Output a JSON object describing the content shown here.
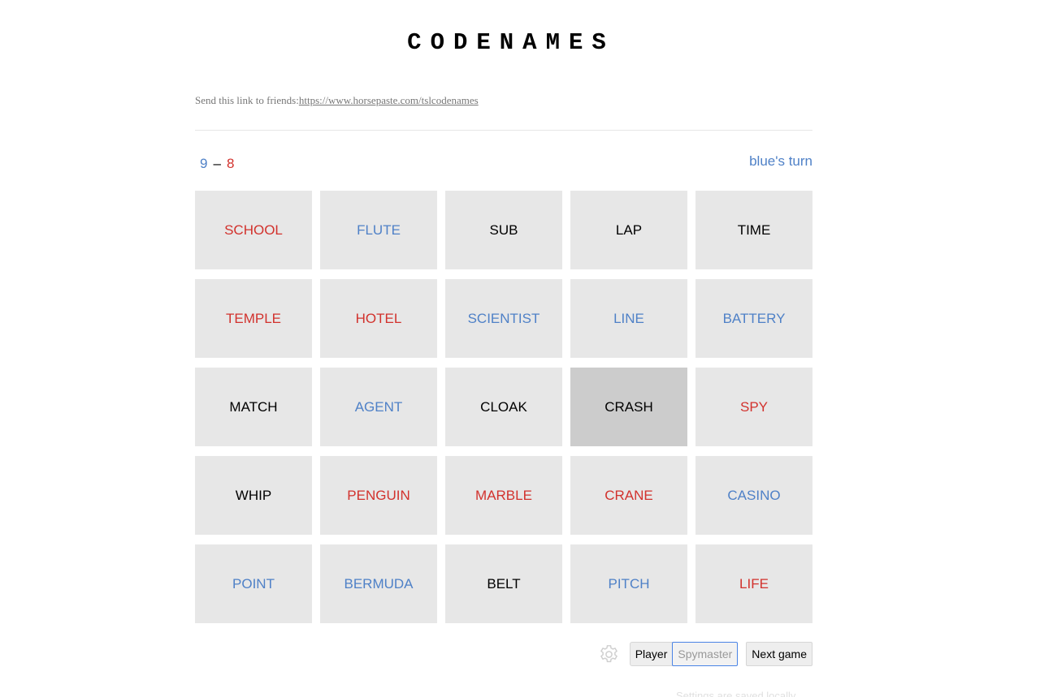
{
  "title": "CODENAMES",
  "share": {
    "label": "Send this link to friends:",
    "link": "https://www.horsepaste.com/tslcodenames"
  },
  "score": {
    "blue_remaining": "9",
    "separator": "–",
    "red_remaining": "8"
  },
  "turn": "blue's turn",
  "colors": {
    "red": "#d2322d",
    "blue": "#4f81c7",
    "card_bg": "#e7e7e7",
    "assassin_bg": "#cccccc"
  },
  "cards": [
    {
      "word": "SCHOOL",
      "team": "red"
    },
    {
      "word": "FLUTE",
      "team": "blue"
    },
    {
      "word": "SUB",
      "team": "neutral"
    },
    {
      "word": "LAP",
      "team": "neutral"
    },
    {
      "word": "TIME",
      "team": "neutral"
    },
    {
      "word": "TEMPLE",
      "team": "red"
    },
    {
      "word": "HOTEL",
      "team": "red"
    },
    {
      "word": "SCIENTIST",
      "team": "blue"
    },
    {
      "word": "LINE",
      "team": "blue"
    },
    {
      "word": "BATTERY",
      "team": "blue"
    },
    {
      "word": "MATCH",
      "team": "neutral"
    },
    {
      "word": "AGENT",
      "team": "blue"
    },
    {
      "word": "CLOAK",
      "team": "neutral"
    },
    {
      "word": "CRASH",
      "team": "assassin"
    },
    {
      "word": "SPY",
      "team": "red"
    },
    {
      "word": "WHIP",
      "team": "neutral"
    },
    {
      "word": "PENGUIN",
      "team": "red"
    },
    {
      "word": "MARBLE",
      "team": "red"
    },
    {
      "word": "CRANE",
      "team": "red"
    },
    {
      "word": "CASINO",
      "team": "blue"
    },
    {
      "word": "POINT",
      "team": "blue"
    },
    {
      "word": "BERMUDA",
      "team": "blue"
    },
    {
      "word": "BELT",
      "team": "neutral"
    },
    {
      "word": "PITCH",
      "team": "blue"
    },
    {
      "word": "LIFE",
      "team": "red"
    }
  ],
  "controls": {
    "settings_icon": "gear-icon",
    "player_label": "Player",
    "spymaster_label": "Spymaster",
    "next_game_label": "Next game"
  },
  "footer_faint": "Settings are saved locally"
}
